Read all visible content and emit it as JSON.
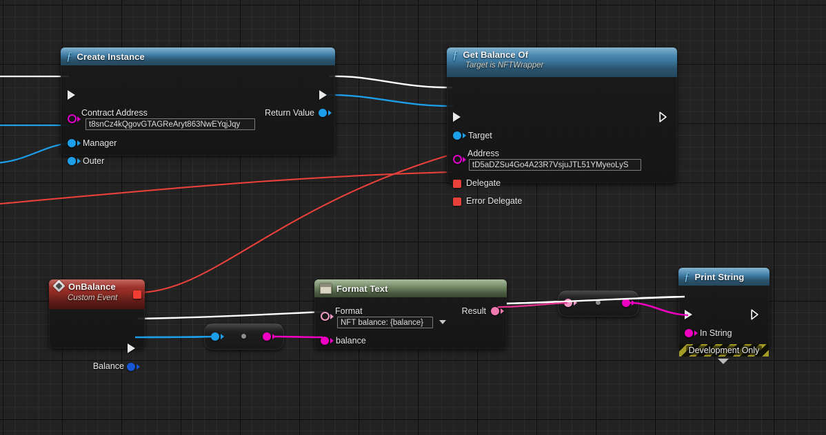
{
  "app": {
    "kind": "blueprint-graph",
    "background_color": "#222222",
    "grid_minor_color": "#2e2e2e",
    "grid_major_color": "#0a0a0a"
  },
  "colors": {
    "exec_white": "#ffffff",
    "object_blue": "#1d9ee8",
    "string_magenta": "#f000c0",
    "text_pink": "#ef9ac4",
    "delegate_red": "#e8403a",
    "header_function": "#3e7ba3",
    "header_event": "#8e2b24",
    "header_pure": "#6e8560",
    "devonly_yellow": "#a39a23"
  },
  "nodes": [
    {
      "id": "create-instance",
      "title": "Create Instance",
      "subtitle": "",
      "type": "function",
      "icon": "function-f-icon",
      "inputs": [
        {
          "name": "exec-in",
          "label": "",
          "pin": "exec"
        },
        {
          "name": "contract-address",
          "label": "Contract Address",
          "pin": "string",
          "value": "t8snCz4kQgovGTAGReAryt863NwEYqjJqy"
        },
        {
          "name": "manager",
          "label": "Manager",
          "pin": "object"
        },
        {
          "name": "outer",
          "label": "Outer",
          "pin": "object"
        }
      ],
      "outputs": [
        {
          "name": "exec-out",
          "label": "",
          "pin": "exec"
        },
        {
          "name": "return-value",
          "label": "Return Value",
          "pin": "object"
        }
      ]
    },
    {
      "id": "get-balance-of",
      "title": "Get Balance Of",
      "subtitle": "Target is NFTWrapper",
      "type": "function",
      "icon": "function-f-icon",
      "inputs": [
        {
          "name": "exec-in",
          "label": "",
          "pin": "exec"
        },
        {
          "name": "target",
          "label": "Target",
          "pin": "object"
        },
        {
          "name": "address",
          "label": "Address",
          "pin": "string",
          "value": "tD5aDZSu4Go4A23R7VsjuJTL51YMyeoLyS"
        },
        {
          "name": "delegate",
          "label": "Delegate",
          "pin": "delegate"
        },
        {
          "name": "error-delegate",
          "label": "Error Delegate",
          "pin": "delegate"
        }
      ],
      "outputs": [
        {
          "name": "exec-out",
          "label": "",
          "pin": "exec-hollow"
        }
      ]
    },
    {
      "id": "onbalance",
      "title": "OnBalance",
      "subtitle": "Custom Event",
      "type": "event",
      "icon": "event-diamond-icon",
      "inputs": [],
      "outputs": [
        {
          "name": "delegate",
          "label": "",
          "pin": "delegate"
        },
        {
          "name": "exec-out",
          "label": "",
          "pin": "exec"
        },
        {
          "name": "balance",
          "label": "Balance",
          "pin": "object"
        }
      ]
    },
    {
      "id": "format-text",
      "title": "Format Text",
      "subtitle": "",
      "type": "pure",
      "icon": "table-icon",
      "inputs": [
        {
          "name": "format",
          "label": "Format",
          "pin": "text",
          "value": "NFT balance: {balance}"
        },
        {
          "name": "balance",
          "label": "balance",
          "pin": "string"
        }
      ],
      "outputs": [
        {
          "name": "result",
          "label": "Result",
          "pin": "text"
        }
      ]
    },
    {
      "id": "print-string",
      "title": "Print String",
      "subtitle": "",
      "type": "function",
      "icon": "function-f-icon",
      "banner": "Development Only",
      "inputs": [
        {
          "name": "exec-in",
          "label": "",
          "pin": "exec"
        },
        {
          "name": "in-string",
          "label": "In String",
          "pin": "string"
        }
      ],
      "outputs": [
        {
          "name": "exec-out",
          "label": "",
          "pin": "exec-hollow"
        }
      ]
    }
  ],
  "knots": [
    {
      "id": "knot-balance",
      "in_pin": "object",
      "out_pin": "string"
    },
    {
      "id": "knot-result",
      "in_pin": "text",
      "out_pin": "string"
    }
  ]
}
